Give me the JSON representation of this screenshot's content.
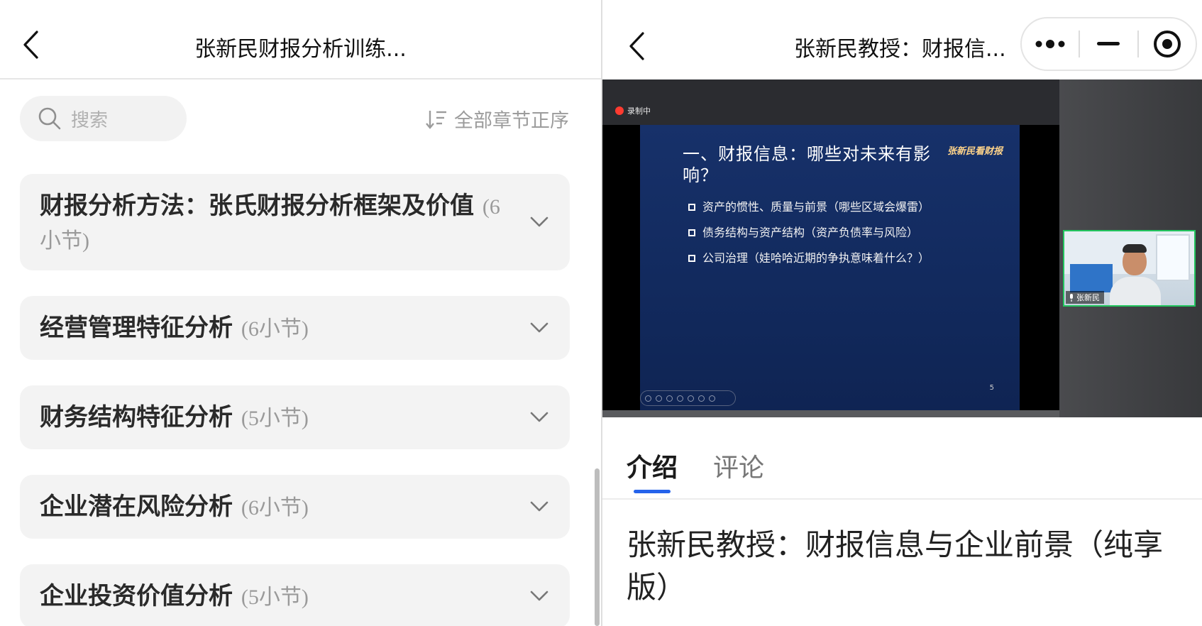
{
  "left": {
    "title": "张新民财报分析训练...",
    "search_placeholder": "搜索",
    "sort_label": "全部章节正序",
    "chapters": [
      {
        "title": "财报分析方法：张氏财报分析框架及价值",
        "count": "(6小节)"
      },
      {
        "title": "经营管理特征分析",
        "count": "(6小节)"
      },
      {
        "title": "财务结构特征分析",
        "count": "(5小节)"
      },
      {
        "title": "企业潜在风险分析",
        "count": "(6小节)"
      },
      {
        "title": "企业投资价值分析",
        "count": "(5小节)"
      }
    ]
  },
  "right": {
    "title": "张新民教授：财报信...",
    "video": {
      "recording_label": "录制中",
      "slide_logo": "张新民看财报",
      "slide_title": "一、财报信息：哪些对未来有影响？",
      "bullets": [
        "资产的惯性、质量与前景（哪些区域会爆雷）",
        "债务结构与资产结构（资产负债率与风险）",
        "公司治理（娃哈哈近期的争执意味着什么？）"
      ],
      "page_number": "5",
      "speaker_name": "张新民"
    },
    "tabs": [
      {
        "label": "介绍",
        "active": true
      },
      {
        "label": "评论",
        "active": false
      }
    ],
    "intro_title": "张新民教授：财报信息与企业前景（纯享版）"
  },
  "colors": {
    "accent": "#2563eb",
    "chapter_bg": "#f3f3f3",
    "camera_border": "#22c55e",
    "slide_bg": "#17316a"
  }
}
